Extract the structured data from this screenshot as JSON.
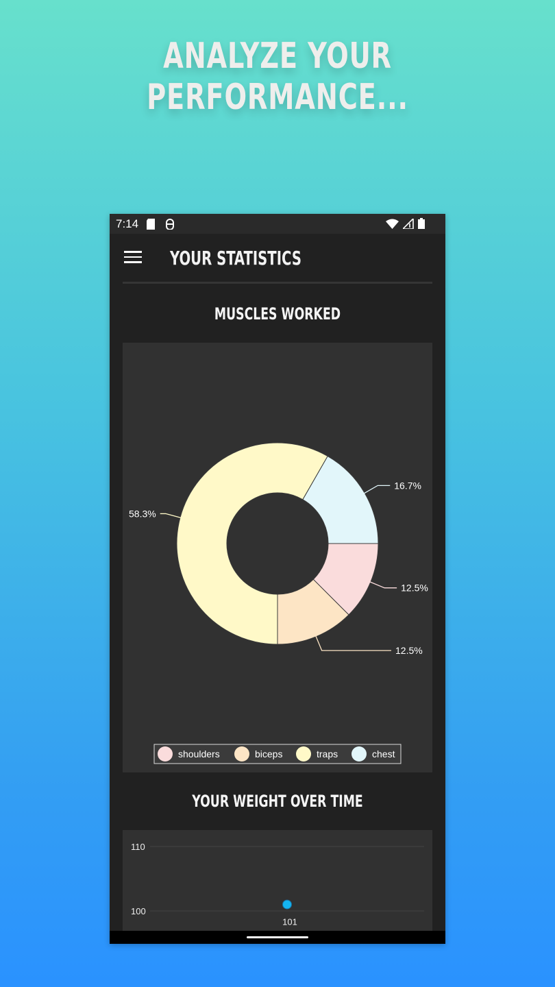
{
  "headline": "ANALYZE YOUR PERFORMANCE...",
  "status_bar": {
    "time": "7:14",
    "left_icons": [
      "sd-card-icon",
      "android-debug-icon"
    ],
    "right_icons": [
      "wifi-icon",
      "cell-signal-icon",
      "battery-icon"
    ]
  },
  "app_bar": {
    "menu_icon": "hamburger-menu-icon",
    "title": "YOUR STATISTICS"
  },
  "muscles_section": {
    "title": "MUSCLES WORKED"
  },
  "weight_section": {
    "title": "YOUR WEIGHT OVER TIME"
  },
  "chart_data": [
    {
      "type": "pie",
      "variant": "donut",
      "title": "",
      "categories": [
        "shoulders",
        "biceps",
        "traps",
        "chest"
      ],
      "values": [
        12.5,
        12.5,
        58.3,
        16.7
      ],
      "labels": [
        "12.5%",
        "12.5%",
        "58.3%",
        "16.7%"
      ],
      "colors": [
        "#fadcdc",
        "#fde5c5",
        "#fff9c8",
        "#e2f6fa"
      ],
      "legend": "bottom"
    },
    {
      "type": "scatter",
      "title": "",
      "y_ticks": [
        "110",
        "100"
      ],
      "points": [
        {
          "y": 101,
          "label": "101"
        }
      ],
      "grid": true,
      "point_color": "#14b4f0"
    }
  ],
  "colors": {
    "phone_bg": "#212121",
    "card_bg": "#313131",
    "accent": "#14b4f0"
  }
}
